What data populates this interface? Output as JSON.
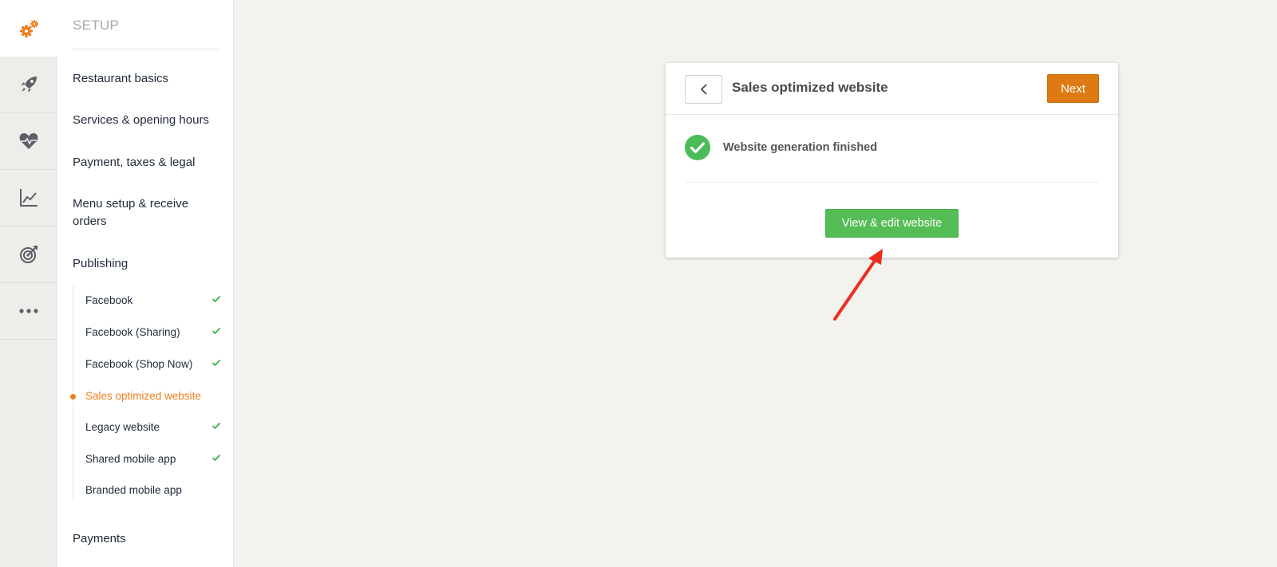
{
  "sidebar": {
    "title": "SETUP",
    "items": [
      {
        "label": "Restaurant basics"
      },
      {
        "label": "Services & opening hours"
      },
      {
        "label": "Payment, taxes & legal"
      },
      {
        "label": "Menu setup & receive orders"
      },
      {
        "label": "Publishing"
      },
      {
        "label": "Payments"
      }
    ],
    "publishing_subitems": [
      {
        "label": "Facebook",
        "status": "done"
      },
      {
        "label": "Facebook (Sharing)",
        "status": "done"
      },
      {
        "label": "Facebook (Shop Now)",
        "status": "done"
      },
      {
        "label": "Sales optimized website",
        "status": "current"
      },
      {
        "label": "Legacy website",
        "status": "done"
      },
      {
        "label": "Shared mobile app",
        "status": "done"
      },
      {
        "label": "Branded mobile app",
        "status": "none"
      }
    ]
  },
  "rail": {
    "icons": [
      "setup-gears-icon",
      "rocket-icon",
      "heart-pulse-icon",
      "chart-icon",
      "target-icon",
      "more-dots-icon"
    ]
  },
  "card": {
    "title": "Sales optimized website",
    "next_label": "Next",
    "status_text": "Website generation finished",
    "view_button_label": "View & edit website"
  },
  "colors": {
    "accent_orange": "#dd7a12",
    "success_green": "#55bd55",
    "annotation_red": "#ee2b1e"
  }
}
